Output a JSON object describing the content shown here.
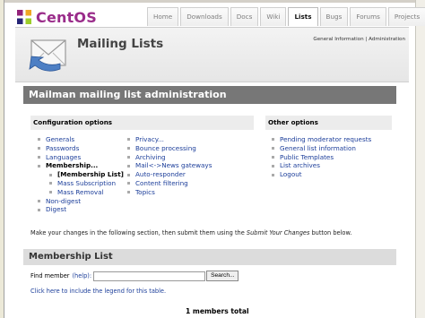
{
  "header": {
    "logo_text": "CentOS",
    "tabs": [
      {
        "label": "Home",
        "active": false
      },
      {
        "label": "Downloads",
        "active": false
      },
      {
        "label": "Docs",
        "active": false
      },
      {
        "label": "Wiki",
        "active": false
      },
      {
        "label": "Lists",
        "active": true
      },
      {
        "label": "Bugs",
        "active": false
      },
      {
        "label": "Forums",
        "active": false
      },
      {
        "label": "Projects",
        "active": false
      }
    ]
  },
  "page": {
    "title": "Mailing Lists",
    "link_general": "General Information",
    "link_sep": " | ",
    "link_admin": "Administration",
    "banner": "Mailman mailing list administration"
  },
  "config": {
    "heading": "Configuration options",
    "col1": [
      "Generals",
      "Passwords",
      "Languages"
    ],
    "current": "Membership...",
    "membership_sub": [
      "[Membership List]",
      "Mass Subscription",
      "Mass Removal"
    ],
    "col1_after": [
      "Non-digest",
      "Digest"
    ],
    "col2": [
      "Privacy...",
      "Bounce processing",
      "Archiving",
      "Mail<->News gateways",
      "Auto-responder",
      "Content filtering",
      "Topics"
    ]
  },
  "other": {
    "heading": "Other options",
    "items": [
      "Pending moderator requests",
      "General list information",
      "Public Templates",
      "List archives",
      "Logout"
    ]
  },
  "instruction": {
    "before": "Make your changes in the following section, then submit them using the ",
    "emph": "Submit Your Changes",
    "after": " button below."
  },
  "membership_list": {
    "heading": "Membership List",
    "find_label": "Find member",
    "help_text": "(help):",
    "search_button": "Search...",
    "legend_link": "Click here to include the legend for this table.",
    "members_total": "1 members total"
  },
  "colors": {
    "accent_link": "#1c3e9a",
    "banner_bg": "#777777",
    "logo": "#9a2c8a"
  }
}
